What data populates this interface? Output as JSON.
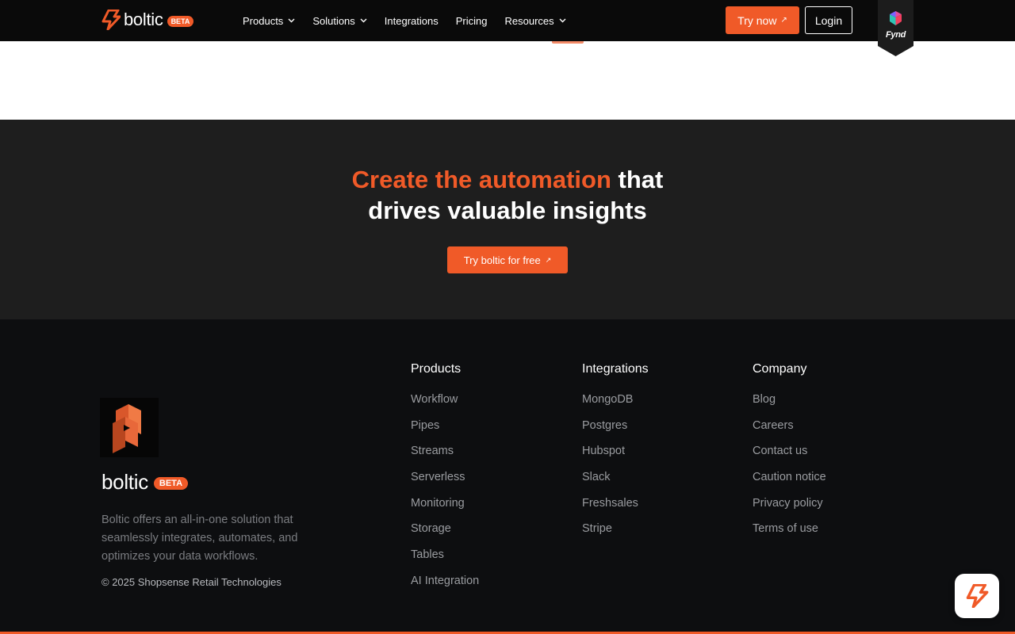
{
  "brand": {
    "name": "boltic",
    "badge": "BETA",
    "accent": "#f05a28"
  },
  "nav": {
    "items": [
      {
        "label": "Products",
        "has_dropdown": true
      },
      {
        "label": "Solutions",
        "has_dropdown": true
      },
      {
        "label": "Integrations",
        "has_dropdown": false
      },
      {
        "label": "Pricing",
        "has_dropdown": false
      },
      {
        "label": "Resources",
        "has_dropdown": true
      }
    ],
    "try_label": "Try now",
    "login_label": "Login",
    "partner_label": "Fynd"
  },
  "cta": {
    "title_accent": "Create the automation",
    "title_rest_1": " that",
    "title_line_2": "drives valuable insights",
    "button_label": "Try boltic for free"
  },
  "footer": {
    "brand_name": "boltic",
    "badge": "BETA",
    "description": "Boltic offers an all-in-one solution that seamlessly integrates, automates, and optimizes your data workflows.",
    "copyright": "© 2025 Shopsense Retail Technologies",
    "columns": [
      {
        "title": "Products",
        "links": [
          "Workflow",
          "Pipes",
          "Streams",
          "Serverless",
          "Monitoring",
          "Storage",
          "Tables",
          "AI Integration"
        ]
      },
      {
        "title": "Integrations",
        "links": [
          "MongoDB",
          "Postgres",
          "Hubspot",
          "Slack",
          "Freshsales",
          "Stripe"
        ]
      },
      {
        "title": "Company",
        "links": [
          "Blog",
          "Careers",
          "Contact us",
          "Caution notice",
          "Privacy policy",
          "Terms of use"
        ]
      }
    ]
  },
  "icons": {
    "logo": "bolt-icon",
    "dropdown": "chevron-down-icon",
    "external": "arrow-up-right-icon",
    "partner": "fynd-logo-icon",
    "chat": "bolt-chat-icon"
  }
}
